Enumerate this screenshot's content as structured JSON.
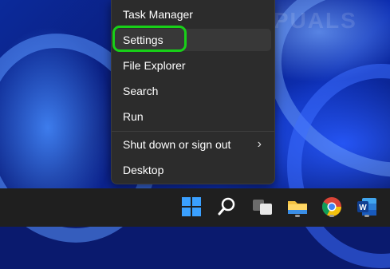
{
  "watermark": "APPUALS",
  "menu": {
    "items": [
      {
        "label": "Task Manager"
      },
      {
        "label": "Settings"
      },
      {
        "label": "File Explorer"
      },
      {
        "label": "Search"
      },
      {
        "label": "Run"
      },
      {
        "label": "Shut down or sign out",
        "has_submenu": true
      },
      {
        "label": "Desktop"
      }
    ],
    "highlighted_item": "Settings",
    "highlight_color": "#18d018"
  },
  "taskbar": {
    "icons": [
      "start-icon",
      "search-icon",
      "task-view-icon",
      "file-explorer-icon",
      "chrome-icon",
      "word-icon"
    ],
    "accent": "#0078d4"
  }
}
